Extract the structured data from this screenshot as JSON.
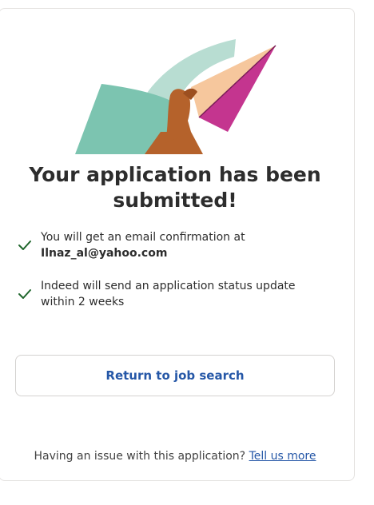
{
  "title": "Your application has been submitted!",
  "checklist": [
    {
      "text": "You will get an email confirmation at",
      "email": "Ilnaz_al@yahoo.com"
    },
    {
      "text": "Indeed will send an application status update within 2 weeks"
    }
  ],
  "actions": {
    "return_label": "Return to job search"
  },
  "footer": {
    "question": "Having an issue with this application?",
    "link_label": "Tell us more"
  },
  "icons": {
    "check": "check-icon",
    "illustration": "paper-plane-illustration"
  },
  "colors": {
    "check": "#1f662c",
    "link": "#2557a7",
    "teal": "#7cc4b0",
    "light_teal": "#b8ddd2",
    "plane_pink": "#c4358f",
    "plane_peach": "#f6c79d",
    "hand": "#b5622b"
  }
}
